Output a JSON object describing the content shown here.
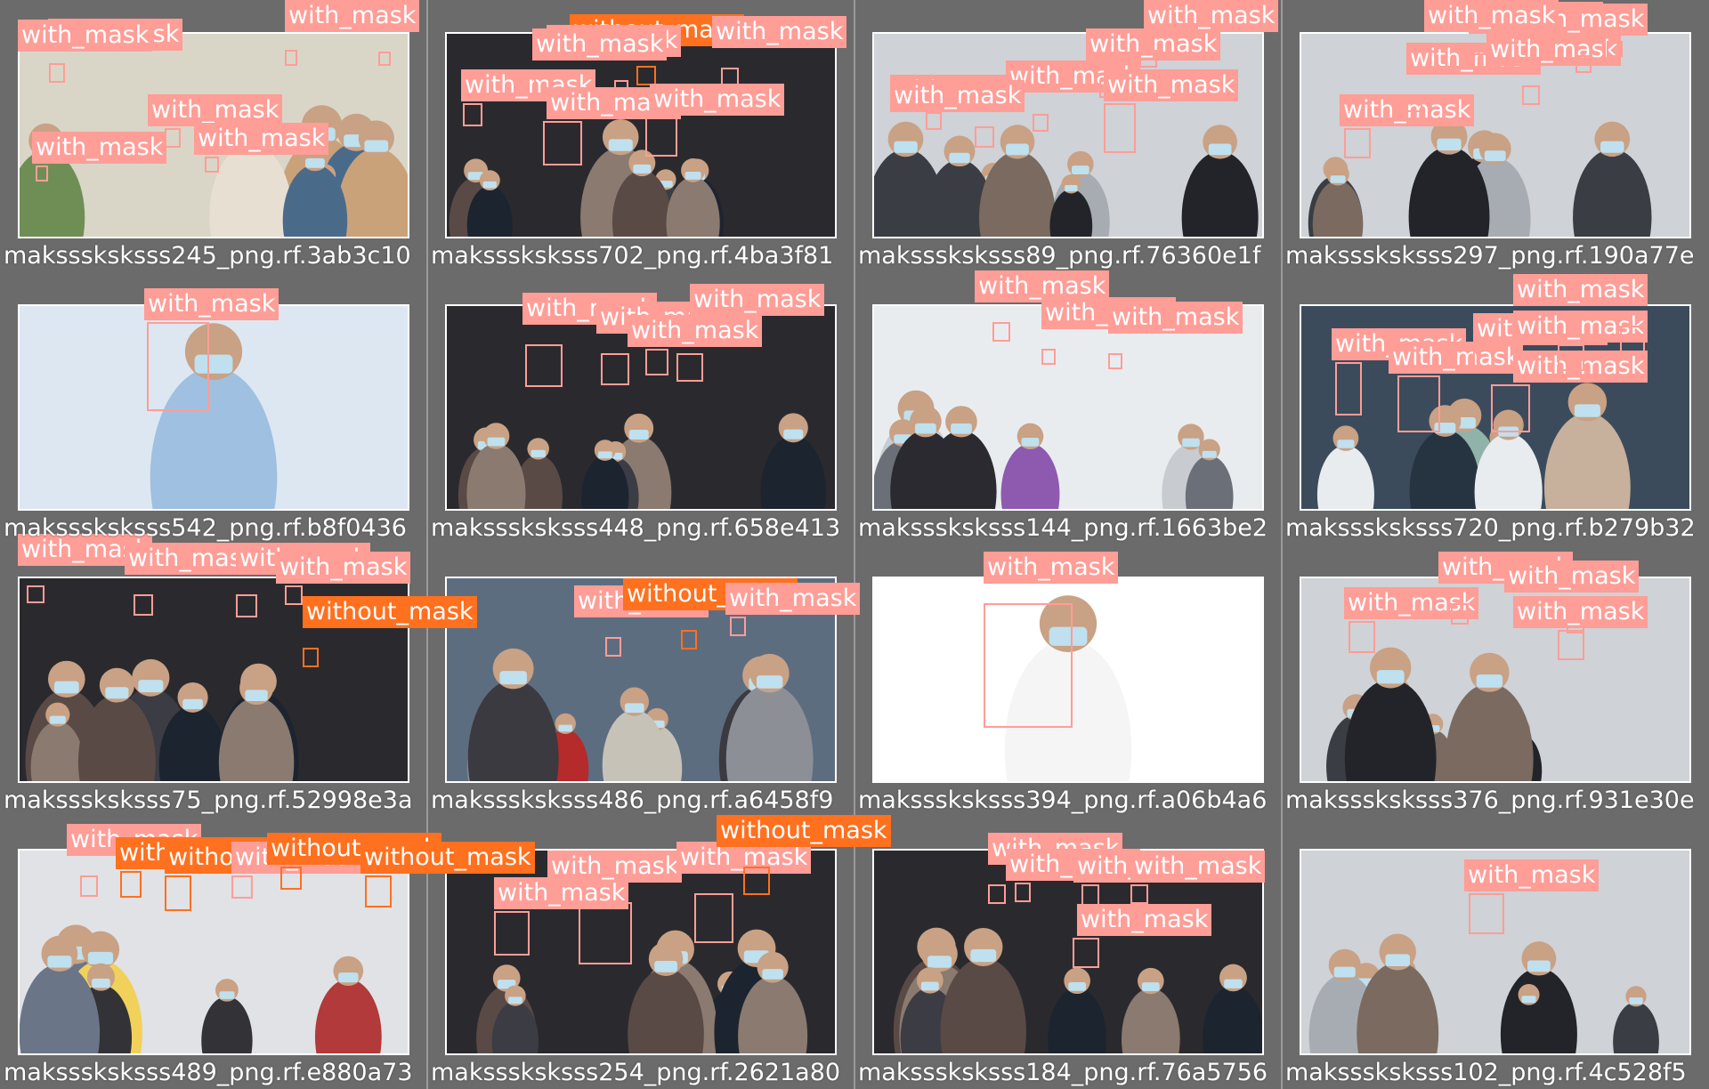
{
  "colors": {
    "with_mask": "#ff9d97",
    "without_mask": "#ff701f",
    "background": "#6b6b6b"
  },
  "labels": {
    "with_mask": "with_mask",
    "without_mask": "without_mask"
  },
  "tiles": [
    {
      "caption": "maksssksksss245_png.rf.3ab3c10",
      "scene": "collage"
    },
    {
      "caption": "maksssksksss702_png.rf.4ba3f81",
      "scene": "crowd"
    },
    {
      "caption": "maksssksksss89_png.rf.76360e1f",
      "scene": "station"
    },
    {
      "caption": "maksssksksss297_png.rf.190a77e",
      "scene": "station"
    },
    {
      "caption": "maksssksksss542_png.rf.b8f0436",
      "scene": "news"
    },
    {
      "caption": "maksssksksss448_png.rf.658e413",
      "scene": "crowd"
    },
    {
      "caption": "maksssksksss144_png.rf.1663be2",
      "scene": "corridor"
    },
    {
      "caption": "maksssksksss720_png.rf.b279b32",
      "scene": "clinic"
    },
    {
      "caption": "maksssksksss75_png.rf.52998e3a",
      "scene": "crowd"
    },
    {
      "caption": "maksssksksss486_png.rf.a6458f9",
      "scene": "street"
    },
    {
      "caption": "maksssksksss394_png.rf.a06b4a6",
      "scene": "portrait"
    },
    {
      "caption": "maksssksksss376_png.rf.931e30e",
      "scene": "station"
    },
    {
      "caption": "maksssksksss489_png.rf.e880a73",
      "scene": "airport"
    },
    {
      "caption": "maksssksksss254_png.rf.2621a80",
      "scene": "crowd"
    },
    {
      "caption": "maksssksksss184_png.rf.76a5756",
      "scene": "crowd"
    },
    {
      "caption": "maksssksksss102_png.rf.4c528f5",
      "scene": "station"
    }
  ],
  "detections": [
    {
      "tile": 0,
      "cls": "with_mask"
    },
    {
      "tile": 0,
      "cls": "with_mask"
    },
    {
      "tile": 0,
      "cls": "with_mask"
    },
    {
      "tile": 0,
      "cls": "with_mask"
    },
    {
      "tile": 0,
      "cls": "with_mask"
    },
    {
      "tile": 0,
      "cls": "with_mask"
    },
    {
      "tile": 1,
      "cls": "with_mask"
    },
    {
      "tile": 1,
      "cls": "without_mask"
    },
    {
      "tile": 1,
      "cls": "with_mask"
    },
    {
      "tile": 1,
      "cls": "with_mask"
    },
    {
      "tile": 1,
      "cls": "with_mask"
    },
    {
      "tile": 1,
      "cls": "with_mask"
    },
    {
      "tile": 1,
      "cls": "with_mask"
    },
    {
      "tile": 2,
      "cls": "with_mask"
    },
    {
      "tile": 2,
      "cls": "with_mask"
    },
    {
      "tile": 2,
      "cls": "with_mask"
    },
    {
      "tile": 2,
      "cls": "with_mask"
    },
    {
      "tile": 2,
      "cls": "with_mask"
    },
    {
      "tile": 2,
      "cls": "with_mask"
    },
    {
      "tile": 3,
      "cls": "with_mask"
    },
    {
      "tile": 3,
      "cls": "with_mask"
    },
    {
      "tile": 3,
      "cls": "with_mask"
    },
    {
      "tile": 3,
      "cls": "with_mask"
    },
    {
      "tile": 3,
      "cls": "with_mask"
    },
    {
      "tile": 3,
      "cls": "with_mask"
    },
    {
      "tile": 4,
      "cls": "with_mask"
    },
    {
      "tile": 5,
      "cls": "with_mask"
    },
    {
      "tile": 5,
      "cls": "with_mask"
    },
    {
      "tile": 5,
      "cls": "with_mask"
    },
    {
      "tile": 5,
      "cls": "with_mask"
    },
    {
      "tile": 6,
      "cls": "with_mask"
    },
    {
      "tile": 6,
      "cls": "with_mask"
    },
    {
      "tile": 6,
      "cls": "with_mask"
    },
    {
      "tile": 7,
      "cls": "with_mask"
    },
    {
      "tile": 7,
      "cls": "with_mask"
    },
    {
      "tile": 7,
      "cls": "with_mask"
    },
    {
      "tile": 7,
      "cls": "with_mask"
    },
    {
      "tile": 7,
      "cls": "with_mask"
    },
    {
      "tile": 7,
      "cls": "with_mask"
    },
    {
      "tile": 8,
      "cls": "with_mask"
    },
    {
      "tile": 8,
      "cls": "with_mask"
    },
    {
      "tile": 8,
      "cls": "with_mask"
    },
    {
      "tile": 8,
      "cls": "with_mask"
    },
    {
      "tile": 8,
      "cls": "without_mask"
    },
    {
      "tile": 9,
      "cls": "without_mask"
    },
    {
      "tile": 9,
      "cls": "with_mask"
    },
    {
      "tile": 9,
      "cls": "without_mask"
    },
    {
      "tile": 9,
      "cls": "with_mask"
    },
    {
      "tile": 10,
      "cls": "with_mask"
    },
    {
      "tile": 11,
      "cls": "with_mask"
    },
    {
      "tile": 11,
      "cls": "with_mask"
    },
    {
      "tile": 11,
      "cls": "with_mask"
    },
    {
      "tile": 11,
      "cls": "with_mask"
    },
    {
      "tile": 12,
      "cls": "with_mask"
    },
    {
      "tile": 12,
      "cls": "without_mask"
    },
    {
      "tile": 12,
      "cls": "without_mask"
    },
    {
      "tile": 12,
      "cls": "with_mask"
    },
    {
      "tile": 12,
      "cls": "without_mask"
    },
    {
      "tile": 12,
      "cls": "without_mask"
    },
    {
      "tile": 13,
      "cls": "with_mask"
    },
    {
      "tile": 13,
      "cls": "with_mask"
    },
    {
      "tile": 13,
      "cls": "with_mask"
    },
    {
      "tile": 13,
      "cls": "without_mask"
    },
    {
      "tile": 14,
      "cls": "with_mask"
    },
    {
      "tile": 14,
      "cls": "with_mask"
    },
    {
      "tile": 14,
      "cls": "with_mask"
    },
    {
      "tile": 14,
      "cls": "with_mask"
    },
    {
      "tile": 14,
      "cls": "with_mask"
    },
    {
      "tile": 15,
      "cls": "with_mask"
    },
    {
      "tile": 15,
      "cls": "with_mask"
    }
  ]
}
